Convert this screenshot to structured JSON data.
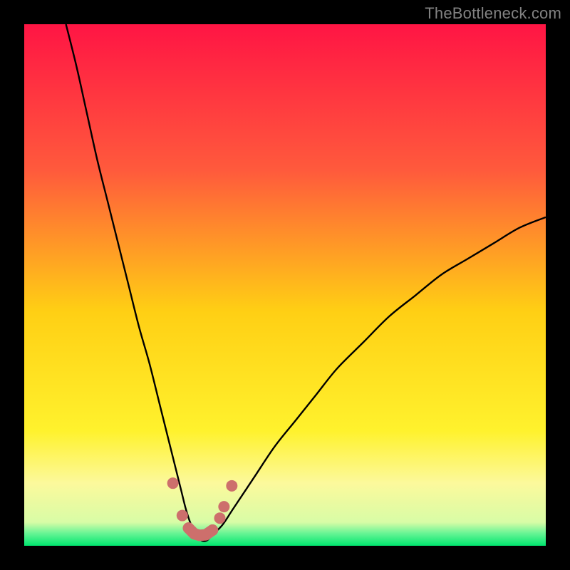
{
  "watermark": "TheBottleneck.com",
  "colors": {
    "bg": "#000000",
    "curve": "#000000",
    "dots": "#cd6f6c",
    "dots_stroke": "#cd6f6c",
    "grad_top": "#ff1544",
    "grad_mid_upper": "#fe8d3c",
    "grad_mid": "#ffe110",
    "grad_yellow_pale": "#fcf99c",
    "grad_bottom_line": "#00e66f",
    "grad_bottom": "#00ff77"
  },
  "chart_data": {
    "type": "line",
    "title": "",
    "xlabel": "",
    "ylabel": "",
    "xlim": [
      0,
      100
    ],
    "ylim": [
      0,
      100
    ],
    "series": [
      {
        "name": "bottleneck-curve",
        "x": [
          8,
          10,
          12,
          14,
          16,
          18,
          20,
          22,
          24,
          26,
          28,
          30,
          31,
          32,
          33,
          34,
          35,
          36,
          38,
          40,
          44,
          48,
          52,
          56,
          60,
          65,
          70,
          75,
          80,
          85,
          90,
          95,
          100
        ],
        "y": [
          100,
          92,
          83,
          74,
          66,
          58,
          50,
          42,
          35,
          27,
          19,
          11,
          7,
          4,
          2,
          1,
          1,
          2,
          4,
          7,
          13,
          19,
          24,
          29,
          34,
          39,
          44,
          48,
          52,
          55,
          58,
          61,
          63
        ]
      }
    ],
    "highlight_points": {
      "name": "near-optimal",
      "x": [
        28.5,
        30.3,
        31.5,
        32.6,
        33.6,
        34.8,
        36.1,
        37.5,
        38.3,
        39.8
      ],
      "y": [
        12.0,
        5.8,
        3.4,
        2.3,
        2.0,
        2.1,
        3.0,
        5.3,
        7.5,
        11.5
      ]
    },
    "gradient_stops": [
      {
        "pos": 0.0,
        "color": "#ff1544"
      },
      {
        "pos": 0.28,
        "color": "#ff5a3c"
      },
      {
        "pos": 0.55,
        "color": "#ffcf14"
      },
      {
        "pos": 0.78,
        "color": "#fff22d"
      },
      {
        "pos": 0.88,
        "color": "#fcf99c"
      },
      {
        "pos": 0.955,
        "color": "#d8fca6"
      },
      {
        "pos": 0.975,
        "color": "#6df596"
      },
      {
        "pos": 1.0,
        "color": "#00e66f"
      }
    ]
  }
}
